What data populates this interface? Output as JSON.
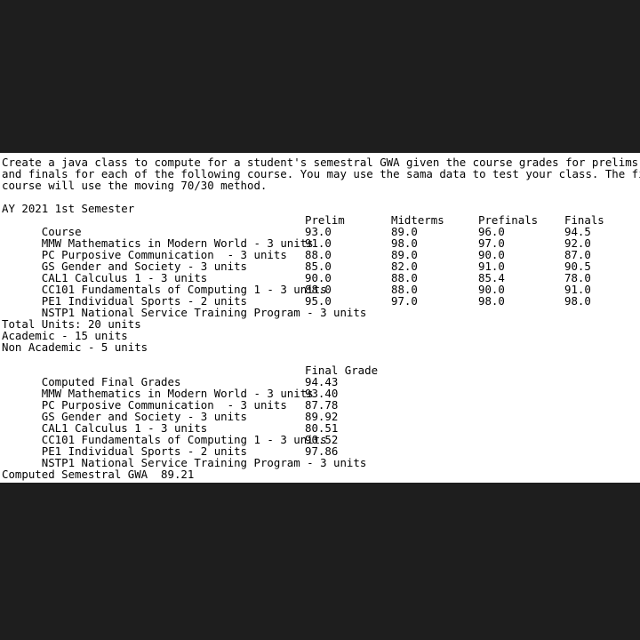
{
  "background_color": "#1e1e1e",
  "panel_color": "#ffffff",
  "text_color": "#000000",
  "document": {
    "prompt": {
      "line1": "Create a java class to compute for a student's semestral GWA given the course grades for prelims, midterms, prefinals",
      "line2": "and finals for each of the following course. You may use the sama data to test your class. The final grade for each",
      "line3": "course will use the moving 70/30 method."
    },
    "term_heading": "AY 2021 1st Semester",
    "grades_table": {
      "headers": [
        "Course",
        "Prelim",
        "Midterms",
        "Prefinals",
        "Finals"
      ],
      "rows": [
        {
          "course": "MMW Mathematics in Modern World - 3 units",
          "prelim": "93.0",
          "midterms": "89.0",
          "prefinals": "96.0",
          "finals": "94.5"
        },
        {
          "course": "PC Purposive Communication  - 3 units",
          "prelim": "91.0",
          "midterms": "98.0",
          "prefinals": "97.0",
          "finals": "92.0"
        },
        {
          "course": "GS Gender and Society - 3 units",
          "prelim": "88.0",
          "midterms": "89.0",
          "prefinals": "90.0",
          "finals": "87.0"
        },
        {
          "course": "CAL1 Calculus 1 - 3 units",
          "prelim": "85.0",
          "midterms": "82.0",
          "prefinals": "91.0",
          "finals": "90.5"
        },
        {
          "course": "CC101 Fundamentals of Computing 1 - 3 units",
          "prelim": "90.0",
          "midterms": "88.0",
          "prefinals": "85.4",
          "finals": "78.0"
        },
        {
          "course": "PE1 Individual Sports - 2 units",
          "prelim": "88.0",
          "midterms": "88.0",
          "prefinals": "90.0",
          "finals": "91.0"
        },
        {
          "course": "NSTP1 National Service Training Program - 3 units",
          "prelim": "95.0",
          "midterms": "97.0",
          "prefinals": "98.0",
          "finals": "98.0"
        }
      ]
    },
    "units_summary": {
      "total": "Total Units: 20 units",
      "academic": "Academic - 15 units",
      "non_academic": "Non Academic - 5 units"
    },
    "final_grades_table": {
      "headers": [
        "Computed Final Grades",
        "Final Grade"
      ],
      "rows": [
        {
          "course": "MMW Mathematics in Modern World - 3 units",
          "final_grade": "94.43"
        },
        {
          "course": "PC Purposive Communication  - 3 units",
          "final_grade": "93.40"
        },
        {
          "course": "GS Gender and Society - 3 units",
          "final_grade": "87.78"
        },
        {
          "course": "CAL1 Calculus 1 - 3 units",
          "final_grade": "89.92"
        },
        {
          "course": "CC101 Fundamentals of Computing 1 - 3 units",
          "final_grade": "80.51"
        },
        {
          "course": "PE1 Individual Sports - 2 units",
          "final_grade": "90.52"
        },
        {
          "course": "NSTP1 National Service Training Program - 3 units",
          "final_grade": "97.86"
        }
      ]
    },
    "gwa_summary": "Computed Semestral GWA  89.21"
  }
}
